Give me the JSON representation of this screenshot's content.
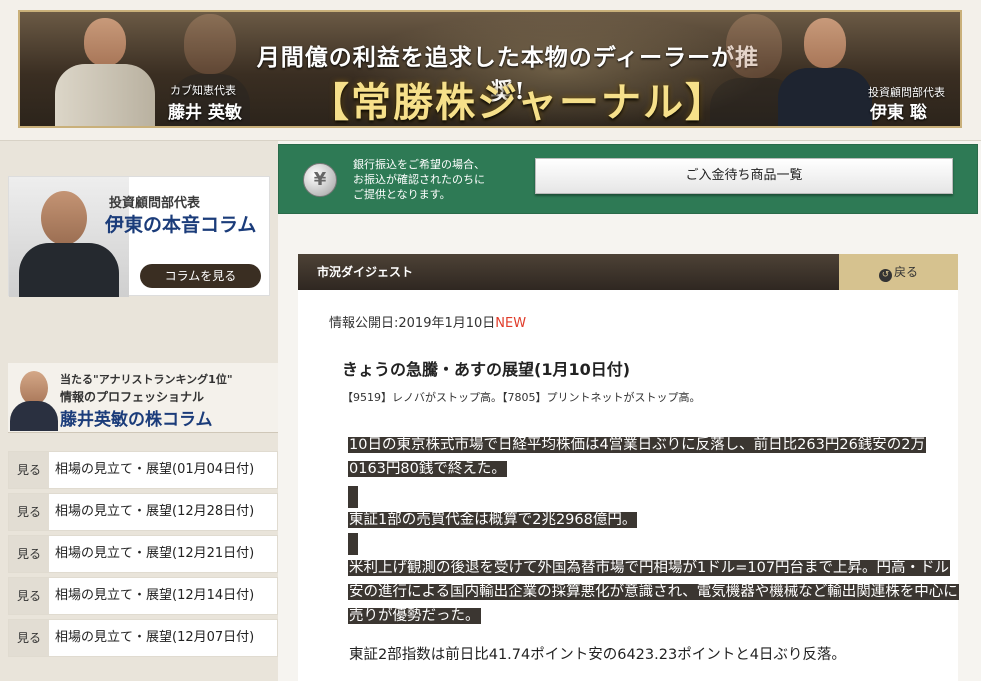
{
  "banner": {
    "headline": "月間億の利益を追求した本物のディーラーが推奨!",
    "title": "【常勝株ジャーナル】",
    "left_role": "カブ知恵代表",
    "left_name": "藤井 英敏",
    "right_role": "投資顧問部代表",
    "right_name": "伊東 聡"
  },
  "sidebar": {
    "column_card": {
      "role": "投資顧問部代表",
      "title": "伊東の本音コラム",
      "button_label": "コラムを見る"
    },
    "fujii_card": {
      "line1": "当たる\"アナリストランキング1位\"",
      "line2": "情報のプロフェッショナル",
      "line3": "藤井英敏の株コラム"
    },
    "articles": [
      {
        "see": "見る",
        "title": "相場の見立て・展望(01月04日付)"
      },
      {
        "see": "見る",
        "title": "相場の見立て・展望(12月28日付)"
      },
      {
        "see": "見る",
        "title": "相場の見立て・展望(12月21日付)"
      },
      {
        "see": "見る",
        "title": "相場の見立て・展望(12月14日付)"
      },
      {
        "see": "見る",
        "title": "相場の見立て・展望(12月07日付)"
      }
    ]
  },
  "payment": {
    "coin_symbol": "¥",
    "message_lines": [
      "銀行振込をご希望の場合、",
      "お振込が確認されたのちに",
      "ご提供となります。"
    ],
    "button_label": "ご入金待ち商品一覧"
  },
  "section": {
    "title": "市況ダイジェスト",
    "back_label": "戻る"
  },
  "article": {
    "date_label": "情報公開日:2019年1月10日",
    "new_badge": "NEW",
    "title": "きょうの急騰・あすの展望(1月10日付)",
    "subtitle": "【9519】レノバがストップ高。【7805】プリントネットがストップ高。",
    "paragraphs": [
      "10日の東京株式市場で日経平均株価は4営業日ぶりに反落し、前日比263円26銭安の2万0163円80銭で終えた。",
      "東証1部の売買代金は概算で2兆2968億円。",
      "米利上げ観測の後退を受けて外国為替市場で円相場が1ドル=107円台まで上昇。円高・ドル安の進行による国内輸出企業の採算悪化が意識され、電気機器や機械など輸出関連株を中心に売りが優勢だった。",
      "東証2部指数は前日比41.74ポイント安の6423.23ポイントと4日ぶり反落。"
    ]
  },
  "colors": {
    "green_bar": "#2e7a55",
    "dark_head": "#3a2e22",
    "gold": "#d6c28f",
    "new_red": "#e03c2a",
    "highlight_bg": "#3b3631"
  }
}
